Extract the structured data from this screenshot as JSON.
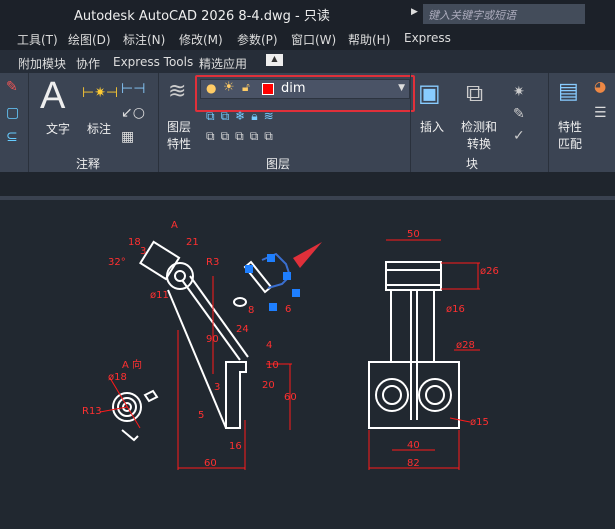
{
  "title": "Autodesk AutoCAD 2026    8-4.dwg - 只读",
  "search_placeholder": "键入关键字或短语",
  "menu": [
    "工具(T)",
    "绘图(D)",
    "标注(N)",
    "修改(M)",
    "参数(P)",
    "窗口(W)",
    "帮助(H)",
    "Express"
  ],
  "tabs": [
    "附加模块",
    "协作",
    "Express Tools",
    "精选应用"
  ],
  "ribbon": {
    "annotation": {
      "text": "文字",
      "dim": "标注",
      "panel": "注释"
    },
    "layers": {
      "props_line1": "图层",
      "props_line2": "特性",
      "current_layer": "dim",
      "layer_color": "#ff0000",
      "panel": "图层"
    },
    "block": {
      "insert": "插入",
      "detect_line1": "检测和",
      "detect_line2": "转换",
      "panel": "块"
    },
    "props": {
      "match_line1": "特性",
      "match_line2": "匹配"
    }
  },
  "drawing": {
    "left_dims": [
      "A",
      "21",
      "18",
      "3",
      "32°",
      "R3",
      "ø11",
      "90",
      "24",
      "4",
      "10",
      "20",
      "60",
      "3",
      "5",
      "16",
      "60",
      "8",
      "6"
    ],
    "view_a": {
      "label": "A 向",
      "dia": "ø18",
      "radius": "R13"
    },
    "right_dims": [
      "50",
      "ø26",
      "ø16",
      "ø28",
      "ø15",
      "40",
      "82"
    ]
  },
  "colors": {
    "accent": "#e0303a",
    "dim": "#ff1a1a",
    "grip": "#1e7fff"
  }
}
